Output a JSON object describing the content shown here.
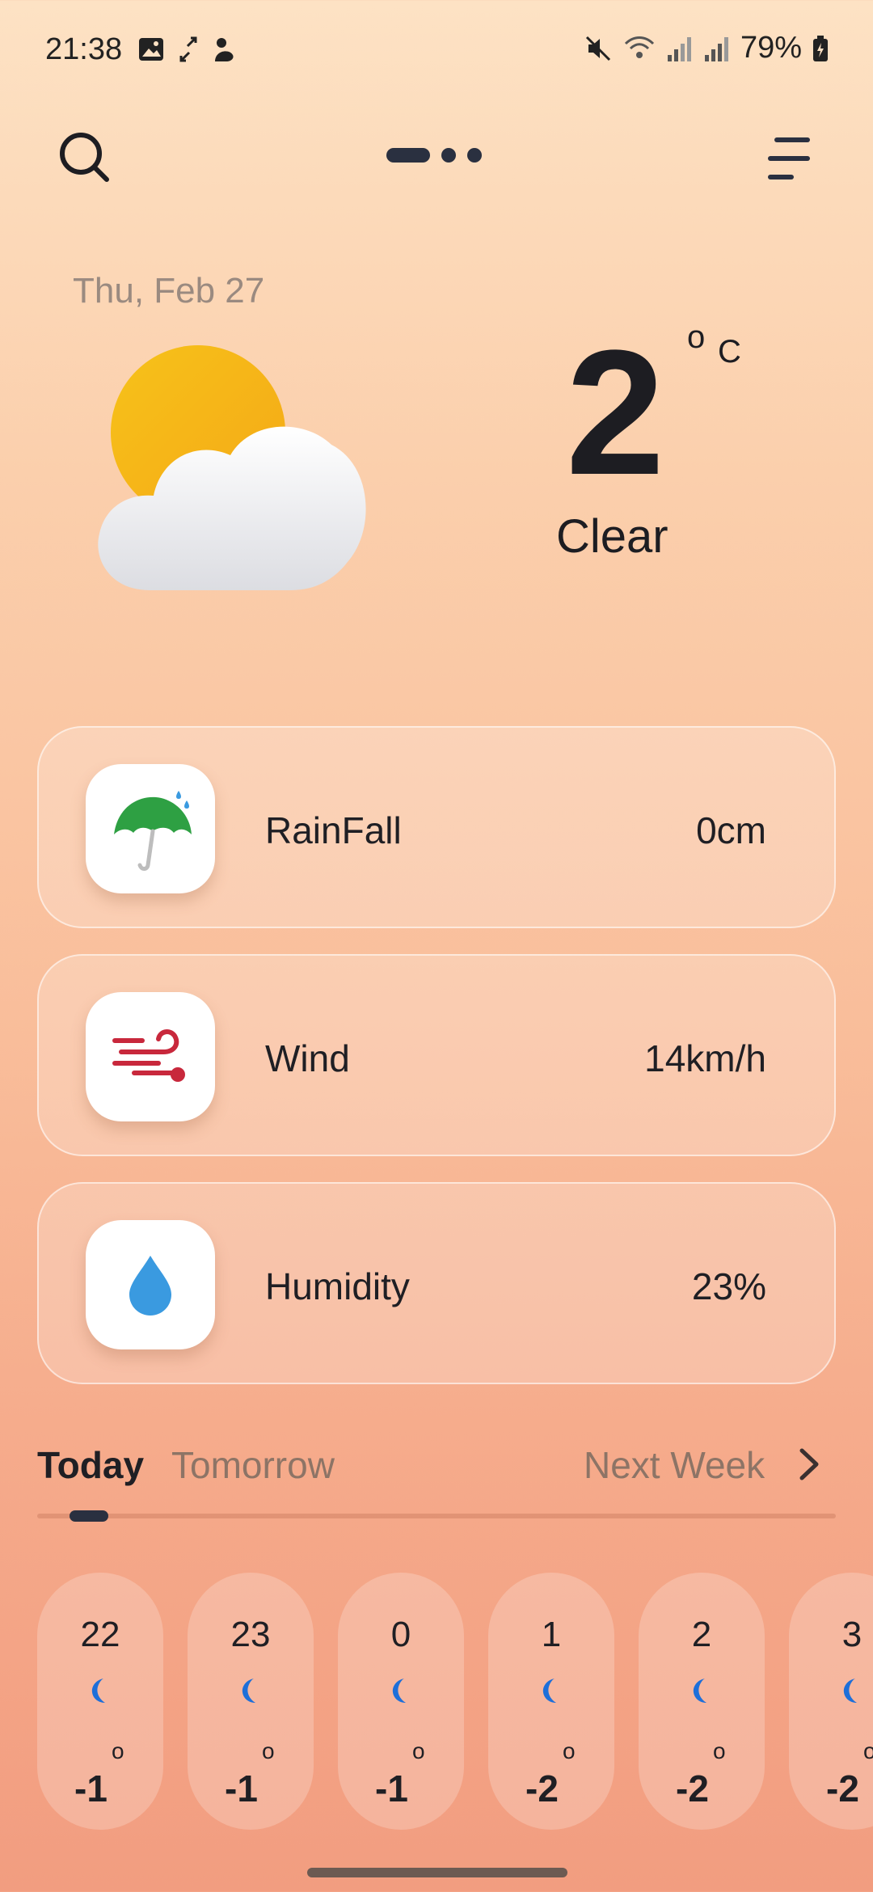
{
  "status_bar": {
    "time": "21:38",
    "battery": "79%"
  },
  "hero": {
    "date": "Thu, Feb 27",
    "temperature": "2",
    "degree_symbol": "o",
    "unit": "C",
    "condition": "Clear",
    "icon": "partly-cloudy-icon"
  },
  "stats": [
    {
      "label": "RainFall",
      "value": "0cm",
      "icon": "umbrella-icon"
    },
    {
      "label": "Wind",
      "value": "14km/h",
      "icon": "wind-icon"
    },
    {
      "label": "Humidity",
      "value": "23%",
      "icon": "droplet-icon"
    }
  ],
  "tabs": {
    "today": "Today",
    "tomorrow": "Tomorrow",
    "next_week": "Next Week",
    "active": "today"
  },
  "hourly": [
    {
      "hour": "22",
      "temp": "-1",
      "deg": "o",
      "icon": "moon-icon"
    },
    {
      "hour": "23",
      "temp": "-1",
      "deg": "o",
      "icon": "moon-icon"
    },
    {
      "hour": "0",
      "temp": "-1",
      "deg": "o",
      "icon": "moon-icon"
    },
    {
      "hour": "1",
      "temp": "-2",
      "deg": "o",
      "icon": "moon-icon"
    },
    {
      "hour": "2",
      "temp": "-2",
      "deg": "o",
      "icon": "moon-icon"
    },
    {
      "hour": "3",
      "temp": "-2",
      "deg": "o",
      "icon": "moon-icon"
    }
  ],
  "colors": {
    "accent_dark": "#2a3040",
    "umbrella_green": "#2ea043",
    "wind_red": "#c8283c",
    "droplet_blue": "#3a9ae0",
    "moon_blue": "#1e6fd9"
  }
}
